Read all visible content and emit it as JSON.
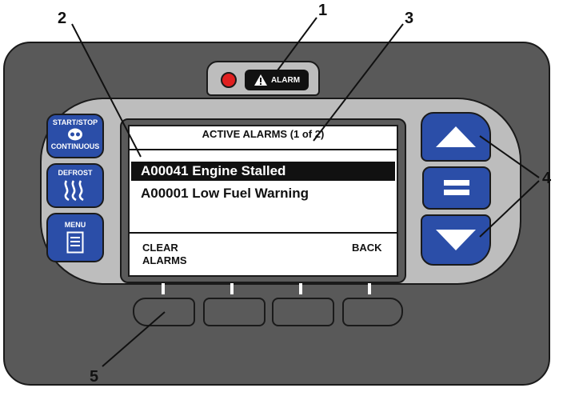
{
  "panel": {
    "alarm_indicator": "ALARM",
    "start_stop_label": "START/STOP",
    "continuous_label": "CONTINUOUS",
    "defrost_label": "DEFROST",
    "menu_label": "MENU"
  },
  "screen": {
    "title": "ACTIVE ALARMS (1 of 2)",
    "alarms": [
      {
        "code": "A00041 Engine Stalled",
        "selected": true
      },
      {
        "code": "A00001 Low Fuel Warning",
        "selected": false
      }
    ],
    "soft_left_line1": "CLEAR",
    "soft_left_line2": "ALARMS",
    "soft_right": "BACK"
  },
  "callouts": [
    "1",
    "2",
    "3",
    "4",
    "5"
  ],
  "colors": {
    "housing": "#595959",
    "bezel": "#bdbdbd",
    "button_blue": "#2b4ea8",
    "led_red": "#e02020"
  }
}
